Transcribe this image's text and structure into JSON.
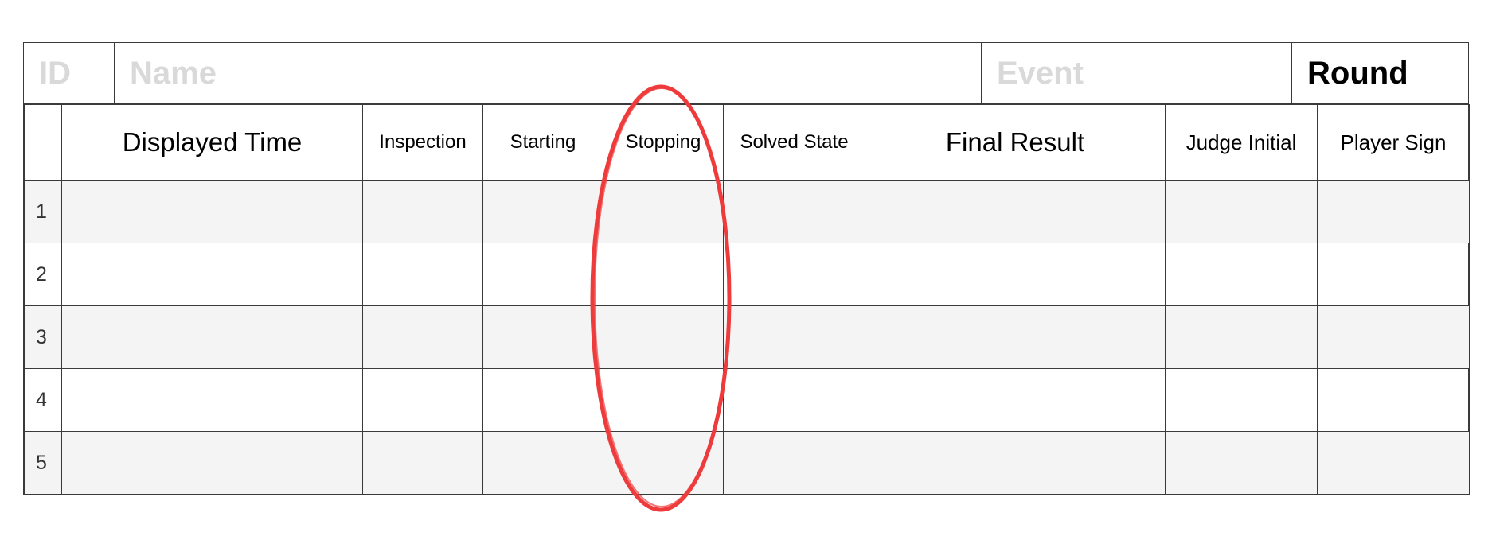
{
  "header": {
    "id_placeholder": "ID",
    "name_placeholder": "Name",
    "event_placeholder": "Event",
    "round_label": "Round"
  },
  "columns": [
    "Displayed Time",
    "Inspection",
    "Starting",
    "Stopping",
    "Solved State",
    "Final Result",
    "Judge Initial",
    "Player Sign"
  ],
  "rows": [
    "1",
    "2",
    "3",
    "4",
    "5"
  ],
  "annotation": {
    "target_column": "Stopping",
    "color": "#ee3b3b"
  }
}
